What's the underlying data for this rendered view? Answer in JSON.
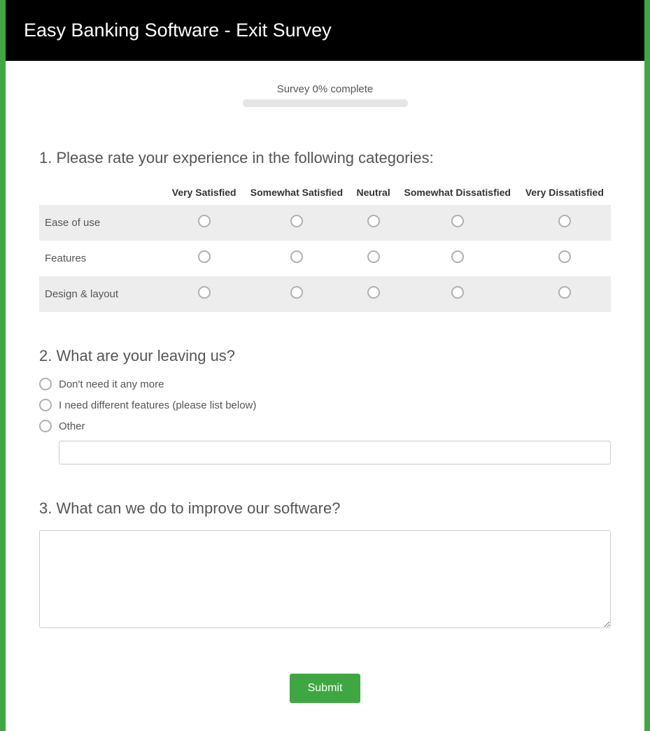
{
  "header": {
    "title": "Easy Banking Software - Exit Survey"
  },
  "progress": {
    "label": "Survey 0% complete",
    "percent": 0
  },
  "questions": {
    "q1": {
      "title": "1. Please rate your experience in the following categories:",
      "columns": {
        "c0": "",
        "c1": "Very Satisfied",
        "c2": "Somewhat Satisfied",
        "c3": "Neutral",
        "c4": "Somewhat Dissatisfied",
        "c5": "Very Dissatisfied"
      },
      "rows": {
        "r1": "Ease of use",
        "r2": "Features",
        "r3": "Design & layout"
      }
    },
    "q2": {
      "title": "2. What are your leaving us?",
      "options": {
        "o1": "Don't need it any more",
        "o2": "I need different features (please list below)",
        "o3": "Other"
      },
      "other_value": ""
    },
    "q3": {
      "title": "3. What can we do to improve our software?",
      "value": ""
    }
  },
  "submit": {
    "label": "Submit"
  }
}
